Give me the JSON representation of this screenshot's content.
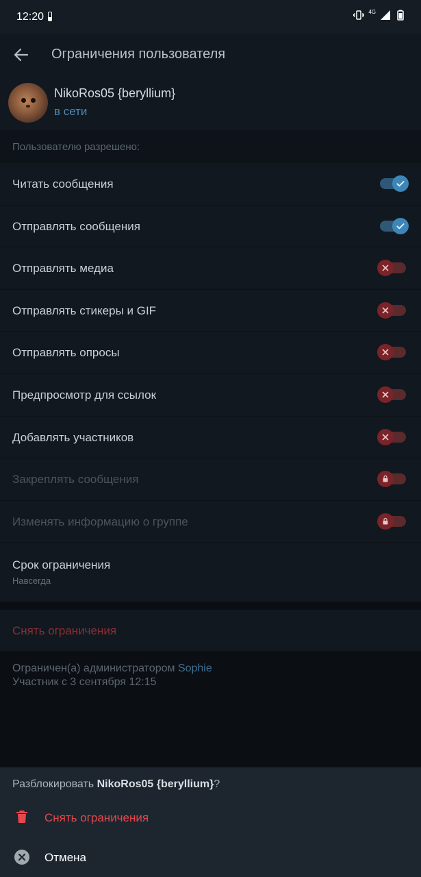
{
  "status_bar": {
    "time": "12:20",
    "network": "4G"
  },
  "app_bar": {
    "title": "Ограничения пользователя",
    "back_icon": "arrow-left-icon"
  },
  "profile": {
    "name": "NikoRos05 {beryllium}",
    "status": "в сети"
  },
  "permissions": {
    "header": "Пользователю разрешено:",
    "items": [
      {
        "label": "Читать сообщения",
        "state": "on",
        "disabled": false
      },
      {
        "label": "Отправлять сообщения",
        "state": "on",
        "disabled": false
      },
      {
        "label": "Отправлять медиа",
        "state": "off",
        "disabled": false
      },
      {
        "label": "Отправлять стикеры и GIF",
        "state": "off",
        "disabled": false
      },
      {
        "label": "Отправлять опросы",
        "state": "off",
        "disabled": false
      },
      {
        "label": "Предпросмотр для ссылок",
        "state": "off",
        "disabled": false
      },
      {
        "label": "Добавлять участников",
        "state": "off",
        "disabled": false
      },
      {
        "label": "Закреплять сообщения",
        "state": "locked",
        "disabled": true
      },
      {
        "label": "Изменять информацию о группе",
        "state": "locked",
        "disabled": true
      }
    ]
  },
  "restriction_term": {
    "label": "Срок ограничения",
    "value": "Навсегда"
  },
  "remove_restrictions": "Снять ограничения",
  "info": {
    "restricted_by_prefix": "Ограничен(а) администратором",
    "admin_name": "Sophie",
    "member_since": "Участник с 3 сентября 12:15"
  },
  "sheet": {
    "question_prefix": "Разблокировать",
    "question_name": "NikoRos05 {beryllium}",
    "question_suffix": "?",
    "actions": [
      {
        "label": "Снять ограничения",
        "icon": "trash-icon",
        "color": "#e5474d"
      },
      {
        "label": "Отмена",
        "icon": "close-circle-icon",
        "color": "#ffffff"
      }
    ]
  },
  "colors": {
    "accent": "#3d86b8",
    "danger": "#e5474d",
    "link": "#4c8ab8"
  }
}
